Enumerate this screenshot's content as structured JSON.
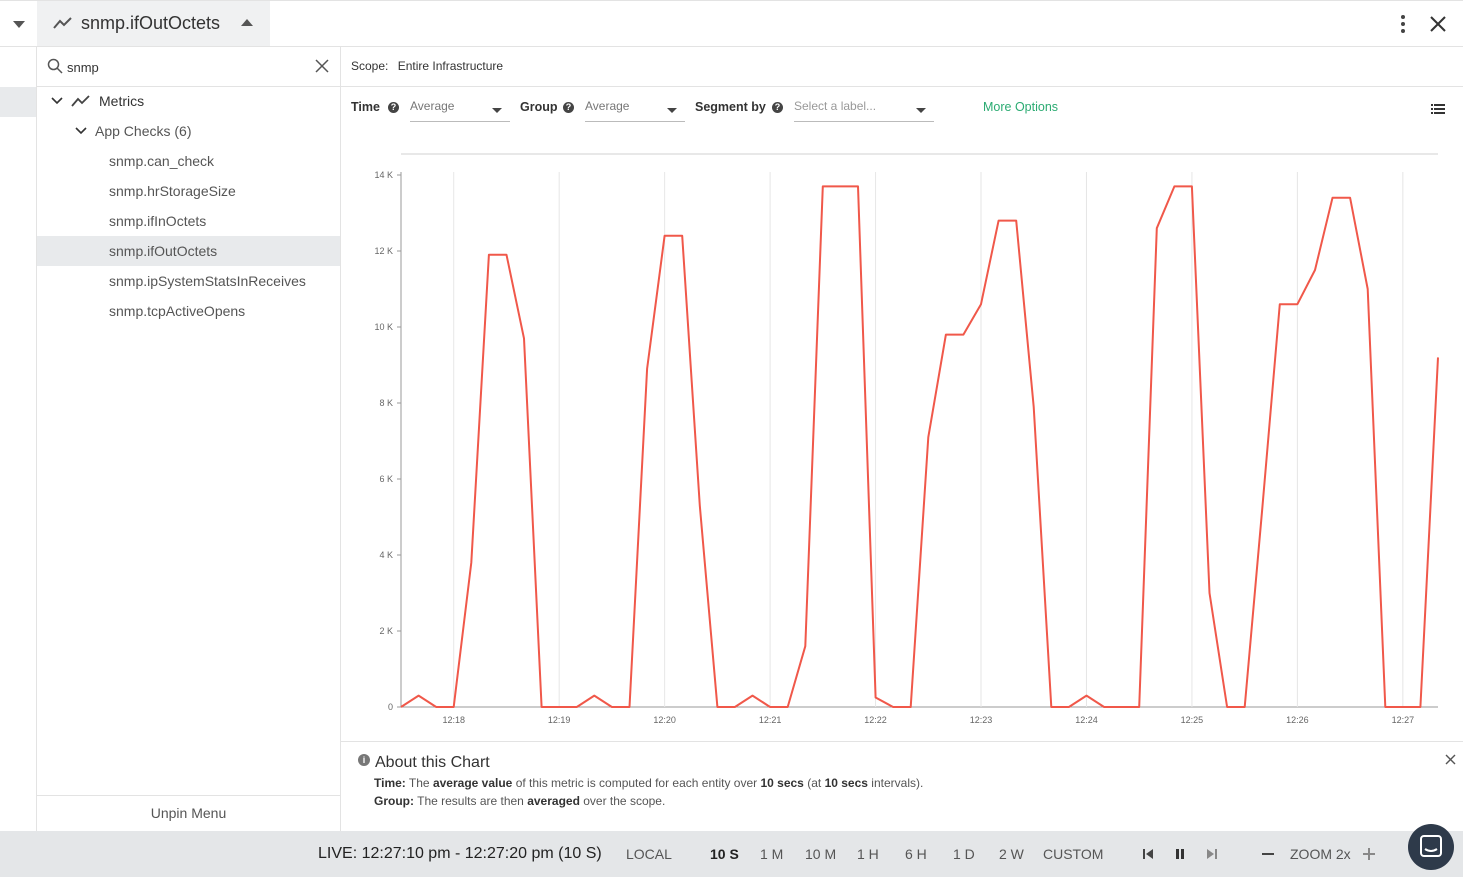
{
  "header": {
    "tab_title": "snmp.ifOutOctets",
    "icons": [
      "collapse-caret-icon",
      "trend-icon",
      "caret-up-icon",
      "kebab-menu-icon",
      "close-icon"
    ]
  },
  "sidebar": {
    "search_value": "snmp",
    "tree": {
      "root_label": "Metrics",
      "group_label": "App Checks (6)",
      "items": [
        "snmp.can_check",
        "snmp.hrStorageSize",
        "snmp.ifInOctets",
        "snmp.ifOutOctets",
        "snmp.ipSystemStatsInReceives",
        "snmp.tcpActiveOpens"
      ],
      "selected_index": 3
    },
    "unpin_label": "Unpin Menu"
  },
  "scope": {
    "label": "Scope:",
    "value": "Entire Infrastructure"
  },
  "controls": {
    "time_label": "Time",
    "time_value": "Average",
    "group_label": "Group",
    "group_value": "Average",
    "segment_label": "Segment by",
    "segment_placeholder": "Select a label...",
    "more_options": "More Options",
    "help_glyph": "?"
  },
  "chart_data": {
    "type": "line",
    "title": "",
    "xlabel": "",
    "ylabel": "",
    "x_ticks": [
      "12:18",
      "12:19",
      "12:20",
      "12:21",
      "12:22",
      "12:23",
      "12:24",
      "12:25",
      "12:26",
      "12:27"
    ],
    "y_ticks": [
      "0",
      "2 K",
      "4 K",
      "6 K",
      "8 K",
      "10 K",
      "12 K",
      "14 K"
    ],
    "xlim": [
      "12:17:30",
      "12:27:20"
    ],
    "ylim": [
      0,
      15000
    ],
    "grid": "vertical",
    "series": [
      {
        "color": "#f0584a",
        "x": [
          "12:17:30",
          "12:17:40",
          "12:17:50",
          "12:18:00",
          "12:18:10",
          "12:18:20",
          "12:18:30",
          "12:18:40",
          "12:18:50",
          "12:19:00",
          "12:19:10",
          "12:19:20",
          "12:19:30",
          "12:19:40",
          "12:19:50",
          "12:20:00",
          "12:20:10",
          "12:20:20",
          "12:20:30",
          "12:20:40",
          "12:20:50",
          "12:21:00",
          "12:21:10",
          "12:21:20",
          "12:21:30",
          "12:21:40",
          "12:21:50",
          "12:22:00",
          "12:22:10",
          "12:22:20",
          "12:22:30",
          "12:22:40",
          "12:22:50",
          "12:23:00",
          "12:23:10",
          "12:23:20",
          "12:23:30",
          "12:23:40",
          "12:23:50",
          "12:24:00",
          "12:24:10",
          "12:24:20",
          "12:24:30",
          "12:24:40",
          "12:24:50",
          "12:25:00",
          "12:25:10",
          "12:25:20",
          "12:25:30",
          "12:25:40",
          "12:25:50",
          "12:26:00",
          "12:26:10",
          "12:26:20",
          "12:26:30",
          "12:26:40",
          "12:26:50",
          "12:27:00",
          "12:27:10",
          "12:27:20"
        ],
        "y": [
          0,
          300,
          0,
          0,
          3800,
          11900,
          11900,
          9700,
          0,
          0,
          0,
          300,
          0,
          0,
          8900,
          12400,
          12400,
          5300,
          0,
          0,
          300,
          0,
          0,
          1600,
          13700,
          13700,
          13700,
          250,
          0,
          0,
          7100,
          9800,
          9800,
          10600,
          12800,
          12800,
          7900,
          0,
          0,
          300,
          0,
          0,
          0,
          12600,
          13700,
          13700,
          3000,
          0,
          0,
          5200,
          10600,
          10600,
          11500,
          13400,
          13400,
          11000,
          0,
          0,
          0,
          9200
        ]
      }
    ]
  },
  "about": {
    "title": "About this Chart",
    "time_label": "Time:",
    "time_text_1": "The",
    "time_bold_1": "average value",
    "time_text_2": "of this metric is computed for each entity over",
    "time_bold_2": "10 secs",
    "time_text_3": "(at",
    "time_bold_3": "10 secs",
    "time_text_4": "intervals).",
    "group_label": "Group:",
    "group_text_1": "The results are then",
    "group_bold_1": "averaged",
    "group_text_2": "over the scope.",
    "info_glyph": "i"
  },
  "bottom_bar": {
    "live_range": "LIVE: 12:27:10 pm - 12:27:20 pm (10 S)",
    "timezone": "LOCAL",
    "ranges": [
      "10 S",
      "1 M",
      "10 M",
      "1 H",
      "6 H",
      "1 D",
      "2 W",
      "CUSTOM"
    ],
    "active_range": "10 S",
    "zoom_label": "ZOOM 2x"
  }
}
